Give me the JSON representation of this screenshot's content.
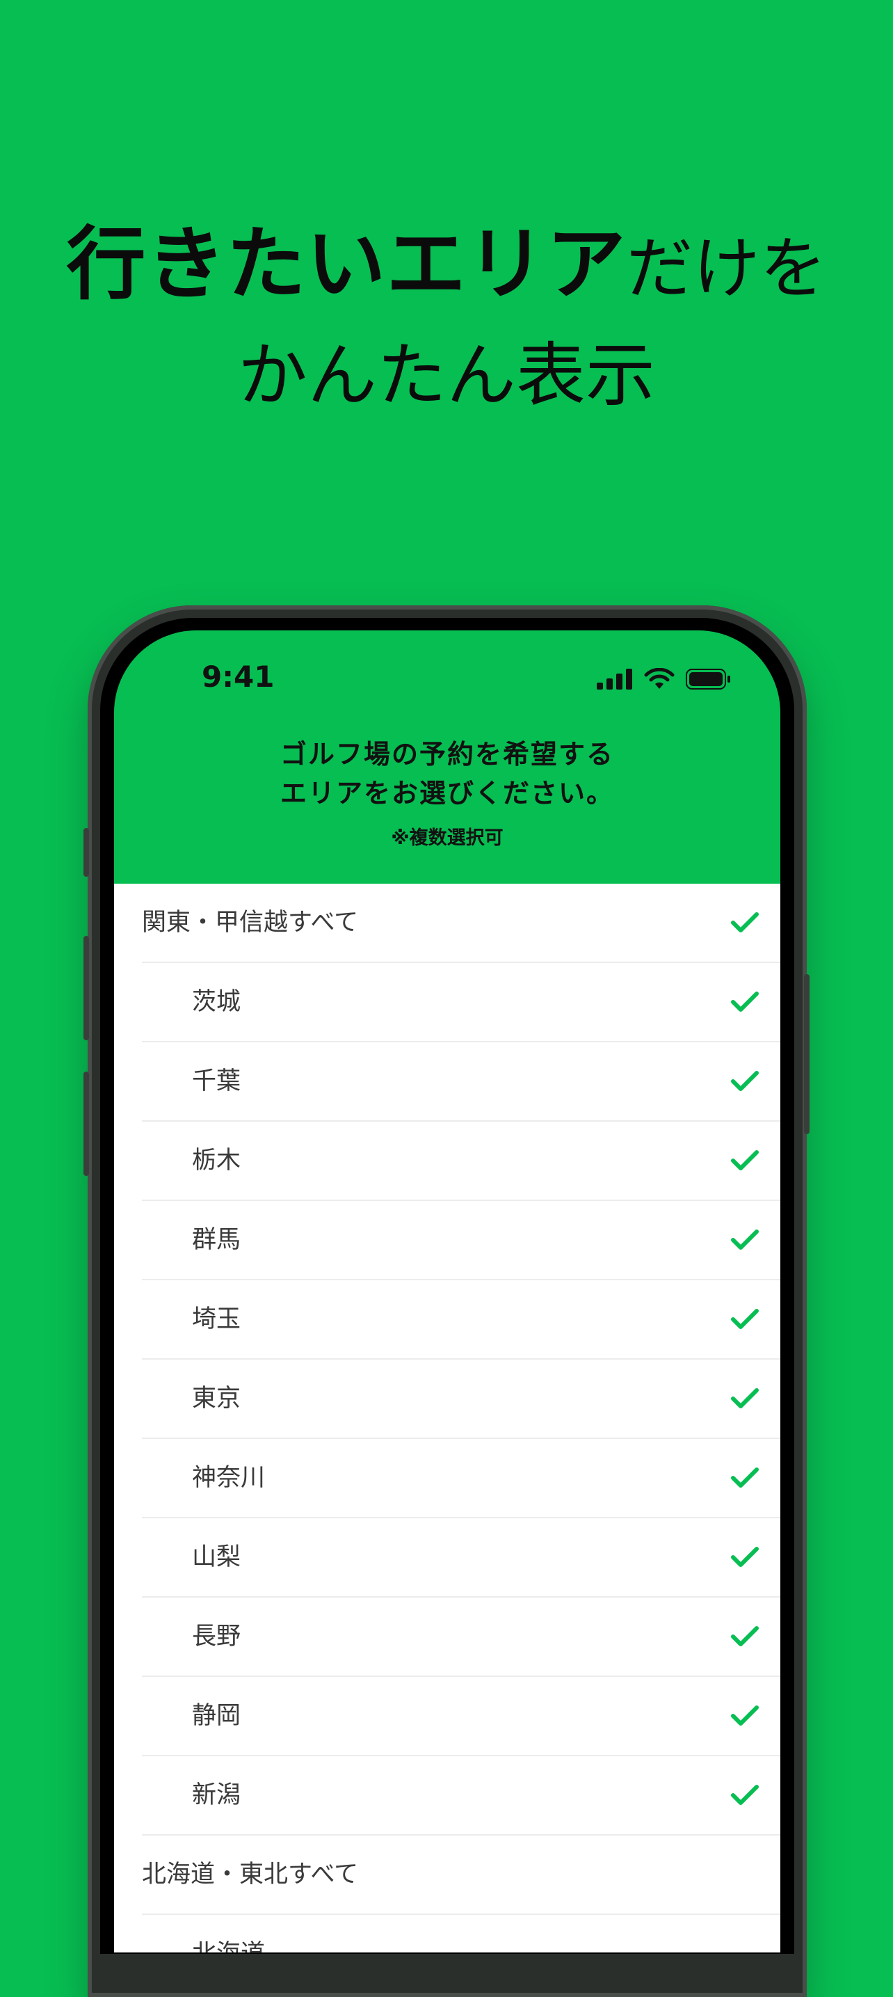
{
  "headline": {
    "line1_bold": "行きたいエリア",
    "line1_rest": "だけを",
    "line2": "かんたん表示"
  },
  "status_bar": {
    "time": "9:41"
  },
  "header": {
    "title_line1": "ゴルフ場の予約を希望する",
    "title_line2": "エリアをお選びください。",
    "note": "※複数選択可"
  },
  "colors": {
    "accent": "#07BE52",
    "check": "#07BE52"
  },
  "areas": [
    {
      "label": "関東・甲信越すべて",
      "level": "parent",
      "checked": true
    },
    {
      "label": "茨城",
      "level": "child",
      "checked": true
    },
    {
      "label": "千葉",
      "level": "child",
      "checked": true
    },
    {
      "label": "栃木",
      "level": "child",
      "checked": true
    },
    {
      "label": "群馬",
      "level": "child",
      "checked": true
    },
    {
      "label": "埼玉",
      "level": "child",
      "checked": true
    },
    {
      "label": "東京",
      "level": "child",
      "checked": true
    },
    {
      "label": "神奈川",
      "level": "child",
      "checked": true
    },
    {
      "label": "山梨",
      "level": "child",
      "checked": true
    },
    {
      "label": "長野",
      "level": "child",
      "checked": true
    },
    {
      "label": "静岡",
      "level": "child",
      "checked": true
    },
    {
      "label": "新潟",
      "level": "child",
      "checked": true
    },
    {
      "label": "北海道・東北すべて",
      "level": "parent",
      "checked": false
    },
    {
      "label": "北海道",
      "level": "child",
      "checked": false
    }
  ]
}
